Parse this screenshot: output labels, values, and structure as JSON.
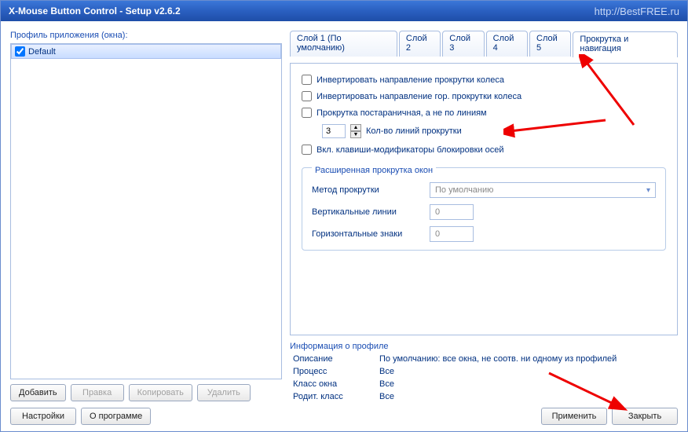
{
  "title": "X-Mouse Button Control - Setup v2.6.2",
  "url_watermark": "http://BestFREE.ru",
  "left": {
    "group_label": "Профиль приложения (окна):",
    "profiles": [
      {
        "name": "Default",
        "checked": true
      }
    ],
    "buttons": {
      "add": "Добавить",
      "edit": "Правка",
      "copy": "Копировать",
      "delete": "Удалить"
    }
  },
  "tabs": {
    "items": [
      "Слой 1 (По умолчанию)",
      "Слой 2",
      "Слой 3",
      "Слой 4",
      "Слой 5",
      "Прокрутка и навигация"
    ],
    "active_index": 5
  },
  "scroll_pane": {
    "invert_wheel": "Инвертировать направление прокрутки колеса",
    "invert_hwheel": "Инвертировать направление гор. прокрутки колеса",
    "page_scroll": "Прокрутка постараничная, а не по линиям",
    "lines_value": "3",
    "lines_label": "Кол-во линий прокрутки",
    "lock_axis": "Вкл. клавиши-модификаторы блокировки осей",
    "advanced": {
      "title": "Расширенная прокрутка окон",
      "method_label": "Метод прокрутки",
      "method_value": "По умолчанию",
      "vert_label": "Вертикальные линии",
      "vert_value": "0",
      "horz_label": "Горизонтальные знаки",
      "horz_value": "0"
    }
  },
  "info": {
    "title": "Информация о профиле",
    "rows": {
      "desc_label": "Описание",
      "desc_value": "По умолчанию: все окна, не соотв. ни одному из профилей",
      "proc_label": "Процесс",
      "proc_value": "Все",
      "class_label": "Класс окна",
      "class_value": "Все",
      "parent_label": "Родит. класс",
      "parent_value": "Все"
    }
  },
  "bottom": {
    "settings": "Настройки",
    "about": "О программе",
    "apply": "Применить",
    "close": "Закрыть"
  }
}
